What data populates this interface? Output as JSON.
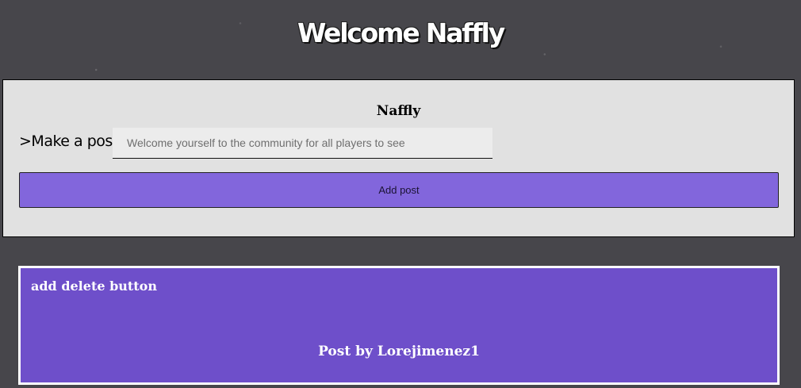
{
  "header": {
    "title": "Welcome Naffly"
  },
  "composer": {
    "username": "Naffly",
    "label": ">Make a post",
    "input_placeholder": "Welcome yourself to the community for all players to see",
    "input_value": "",
    "submit_label": "Add post"
  },
  "posts": [
    {
      "text": "add delete button",
      "byline": "Post by Lorejimenez1"
    }
  ],
  "colors": {
    "background": "#47464b",
    "panel": "#e1e1e1",
    "button": "#8266dc",
    "post_card": "#6e4fca",
    "post_border": "#ffffff"
  }
}
